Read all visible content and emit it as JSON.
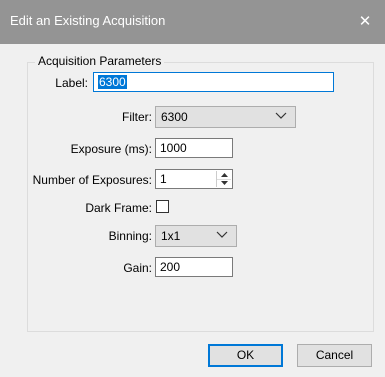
{
  "dialog": {
    "title": "Edit an Existing Acquisition",
    "close_icon": "close-icon"
  },
  "group": {
    "title": "Acquisition Parameters"
  },
  "fields": {
    "label": {
      "label": "Label:",
      "value": "6300"
    },
    "filter": {
      "label": "Filter:",
      "value": "6300"
    },
    "exposure": {
      "label": "Exposure (ms):",
      "value": "1000"
    },
    "num_exposures": {
      "label": "Number of Exposures:",
      "value": "1"
    },
    "dark_frame": {
      "label": "Dark Frame:",
      "checked": false
    },
    "binning": {
      "label": "Binning:",
      "value": "1x1"
    },
    "gain": {
      "label": "Gain:",
      "value": "200"
    }
  },
  "buttons": {
    "ok": "OK",
    "cancel": "Cancel"
  },
  "colors": {
    "titlebar": "#949494",
    "accent": "#0078d7",
    "background": "#f0f0f0"
  }
}
